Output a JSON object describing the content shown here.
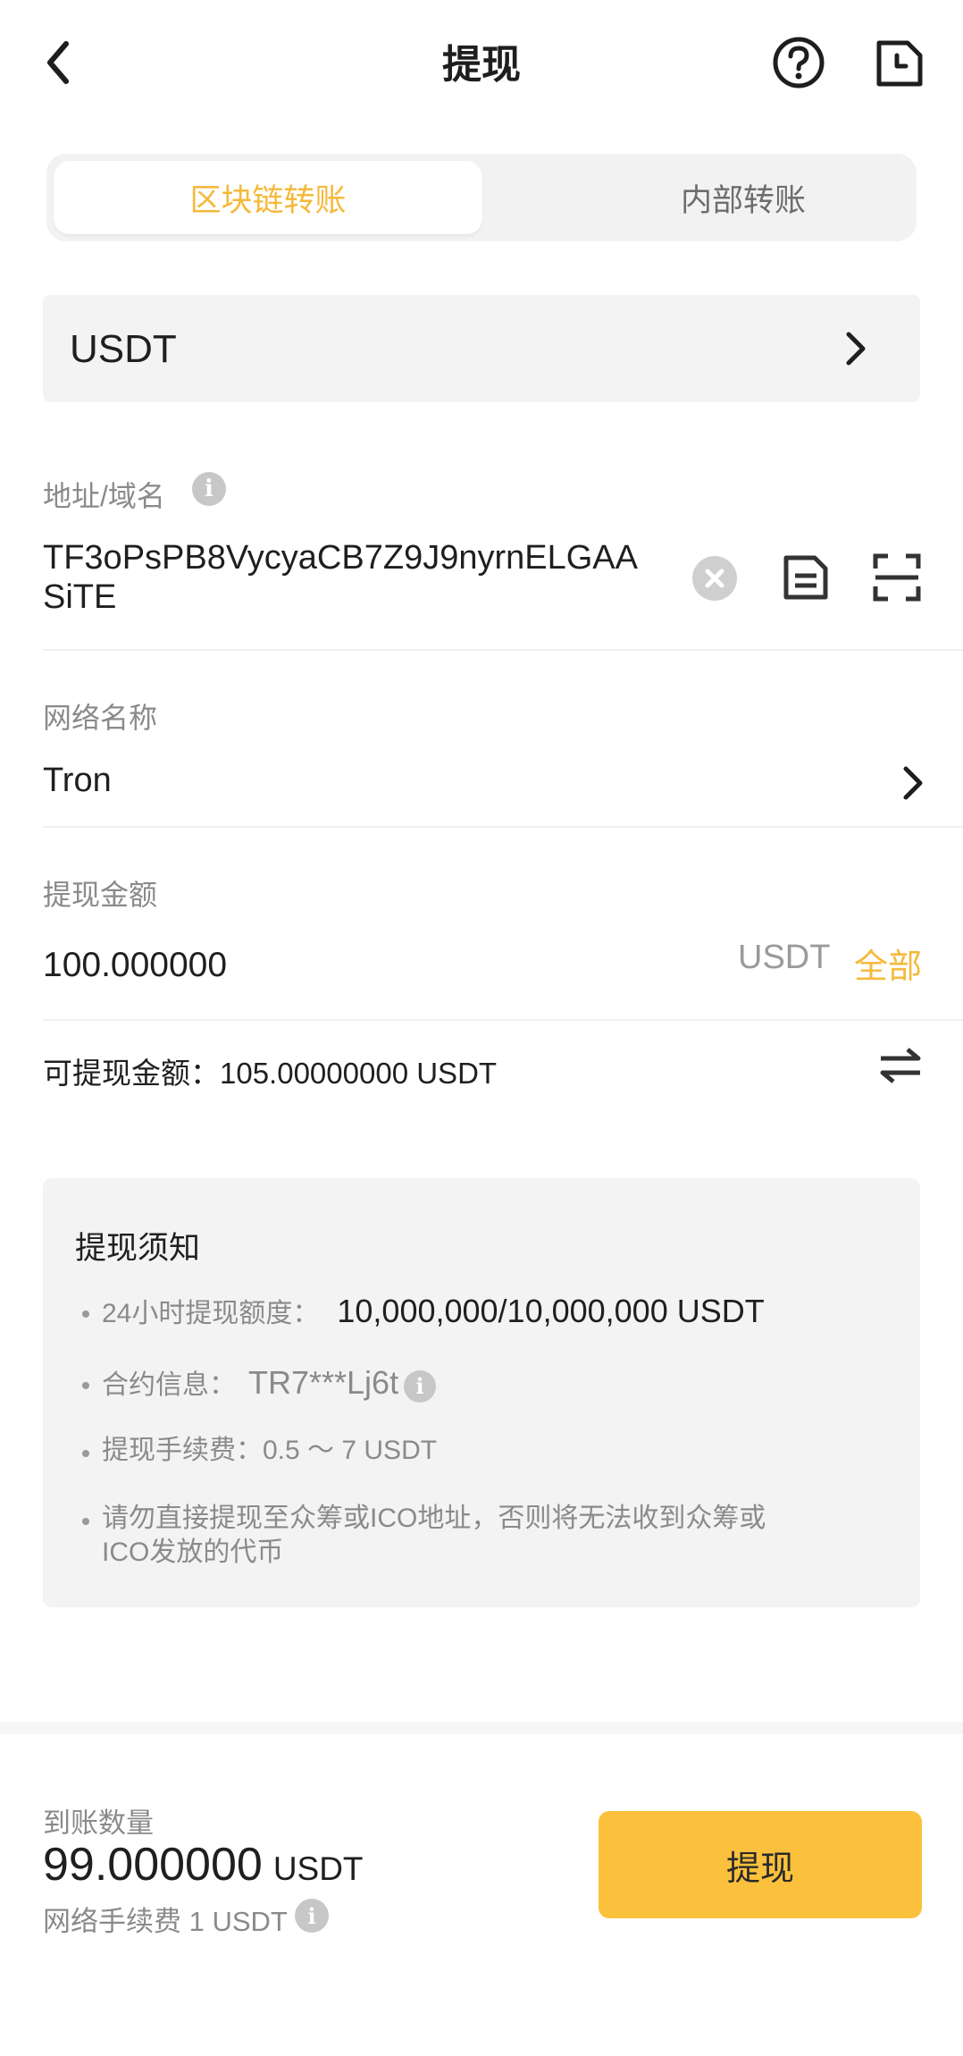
{
  "header": {
    "title": "提现"
  },
  "tabs": [
    {
      "label": "区块链转账",
      "active": true
    },
    {
      "label": "内部转账",
      "active": false
    }
  ],
  "coin": {
    "name": "USDT"
  },
  "address": {
    "label": "地址/域名",
    "value": "TF3oPsPB8VycyaCB7Z9J9nyrnELGAASiTE",
    "info_icon": "i"
  },
  "network": {
    "label": "网络名称",
    "value": "Tron"
  },
  "amount": {
    "label": "提现金额",
    "value": "100.000000",
    "unit": "USDT",
    "max_label": "全部"
  },
  "available": {
    "text": "可提现金额：105.00000000 USDT"
  },
  "notice": {
    "title": "提现须知",
    "limit_label": "24小时提现额度：",
    "limit_value": "10,000,000/10,000,000 USDT",
    "contract_label": "合约信息：",
    "contract_value": "TR7***Lj6t",
    "fee_text": "提现手续费：0.5 ～ 7 USDT",
    "warning_line1": "请勿直接提现至众筹或ICO地址，否则将无法收到众筹或",
    "warning_line2": "ICO发放的代币"
  },
  "footer": {
    "receive_label": "到账数量",
    "receive_amount": "99.000000",
    "receive_unit": "USDT",
    "fee_text": "网络手续费 1 USDT",
    "submit_label": "提现"
  },
  "colors": {
    "accent": "#f5b93a",
    "button": "#fcc13c"
  }
}
